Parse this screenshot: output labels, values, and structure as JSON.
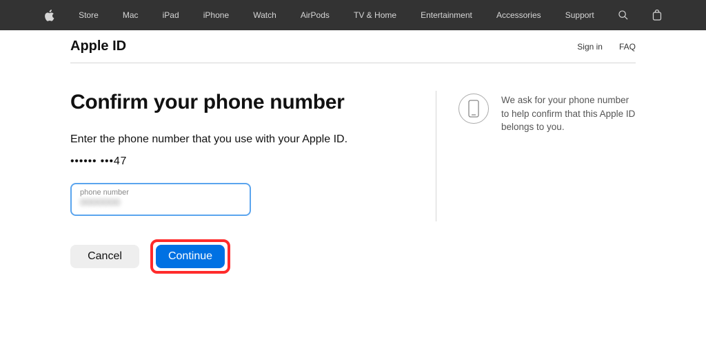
{
  "globalNav": {
    "items": [
      "Store",
      "Mac",
      "iPad",
      "iPhone",
      "Watch",
      "AirPods",
      "TV & Home",
      "Entertainment",
      "Accessories",
      "Support"
    ]
  },
  "localNav": {
    "title": "Apple ID",
    "links": {
      "signIn": "Sign in",
      "faq": "FAQ"
    }
  },
  "main": {
    "heading": "Confirm your phone number",
    "subtitle": "Enter the phone number that you use with your Apple ID.",
    "maskedNumber": "•••••• •••47",
    "input": {
      "label": "phone number",
      "value": ""
    },
    "buttons": {
      "cancel": "Cancel",
      "continue": "Continue"
    }
  },
  "side": {
    "text": "We ask for your phone number to help confirm that this Apple ID belongs to you."
  }
}
